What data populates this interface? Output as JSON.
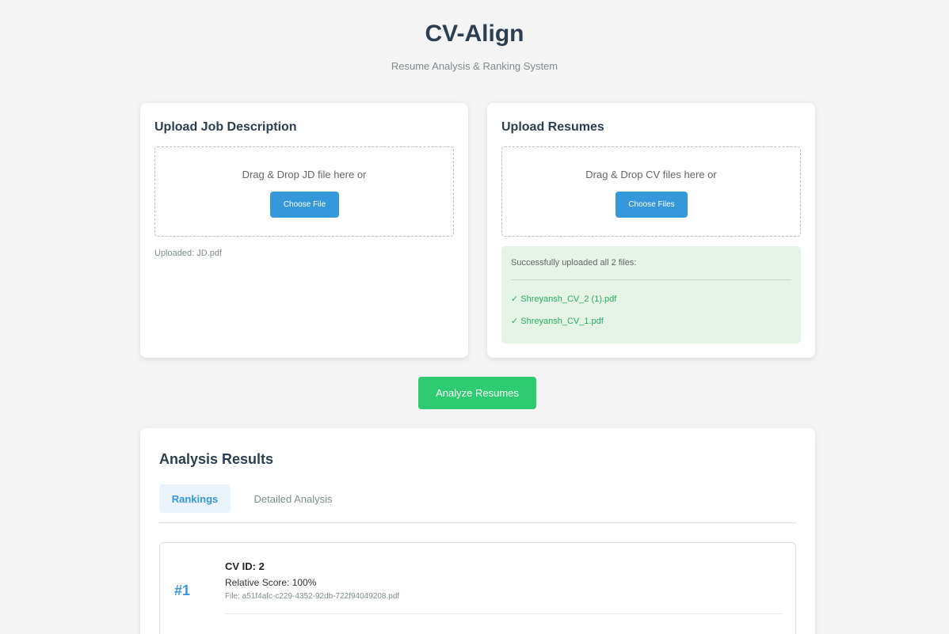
{
  "header": {
    "title": "CV-Align",
    "subtitle": "Resume Analysis & Ranking System"
  },
  "jd_upload": {
    "title": "Upload Job Description",
    "dropzone_text": "Drag & Drop JD file here or",
    "button_label": "Choose File",
    "uploaded_text": "Uploaded: JD.pdf"
  },
  "cv_upload": {
    "title": "Upload Resumes",
    "dropzone_text": "Drag & Drop CV files here or",
    "button_label": "Choose Files",
    "success_title": "Successfully uploaded all 2 files:",
    "files": [
      "✓ Shreyansh_CV_2 (1).pdf",
      "✓ Shreyansh_CV_1.pdf"
    ]
  },
  "analyze_button": "Analyze Resumes",
  "results": {
    "title": "Analysis Results",
    "tabs": [
      {
        "label": "Rankings",
        "active": true
      },
      {
        "label": "Detailed Analysis",
        "active": false
      }
    ],
    "rankings": [
      {
        "rank": "#1",
        "cv_id": "CV ID: 2",
        "relative_score": "Relative Score: 100%",
        "file": "File: a51f4afc-c229-4352-92db-722f94049208.pdf"
      }
    ]
  },
  "colors": {
    "primary": "#3498db",
    "success": "#2ecc71",
    "text_dark": "#2c3e50",
    "success_bg": "#e6f4e8"
  }
}
